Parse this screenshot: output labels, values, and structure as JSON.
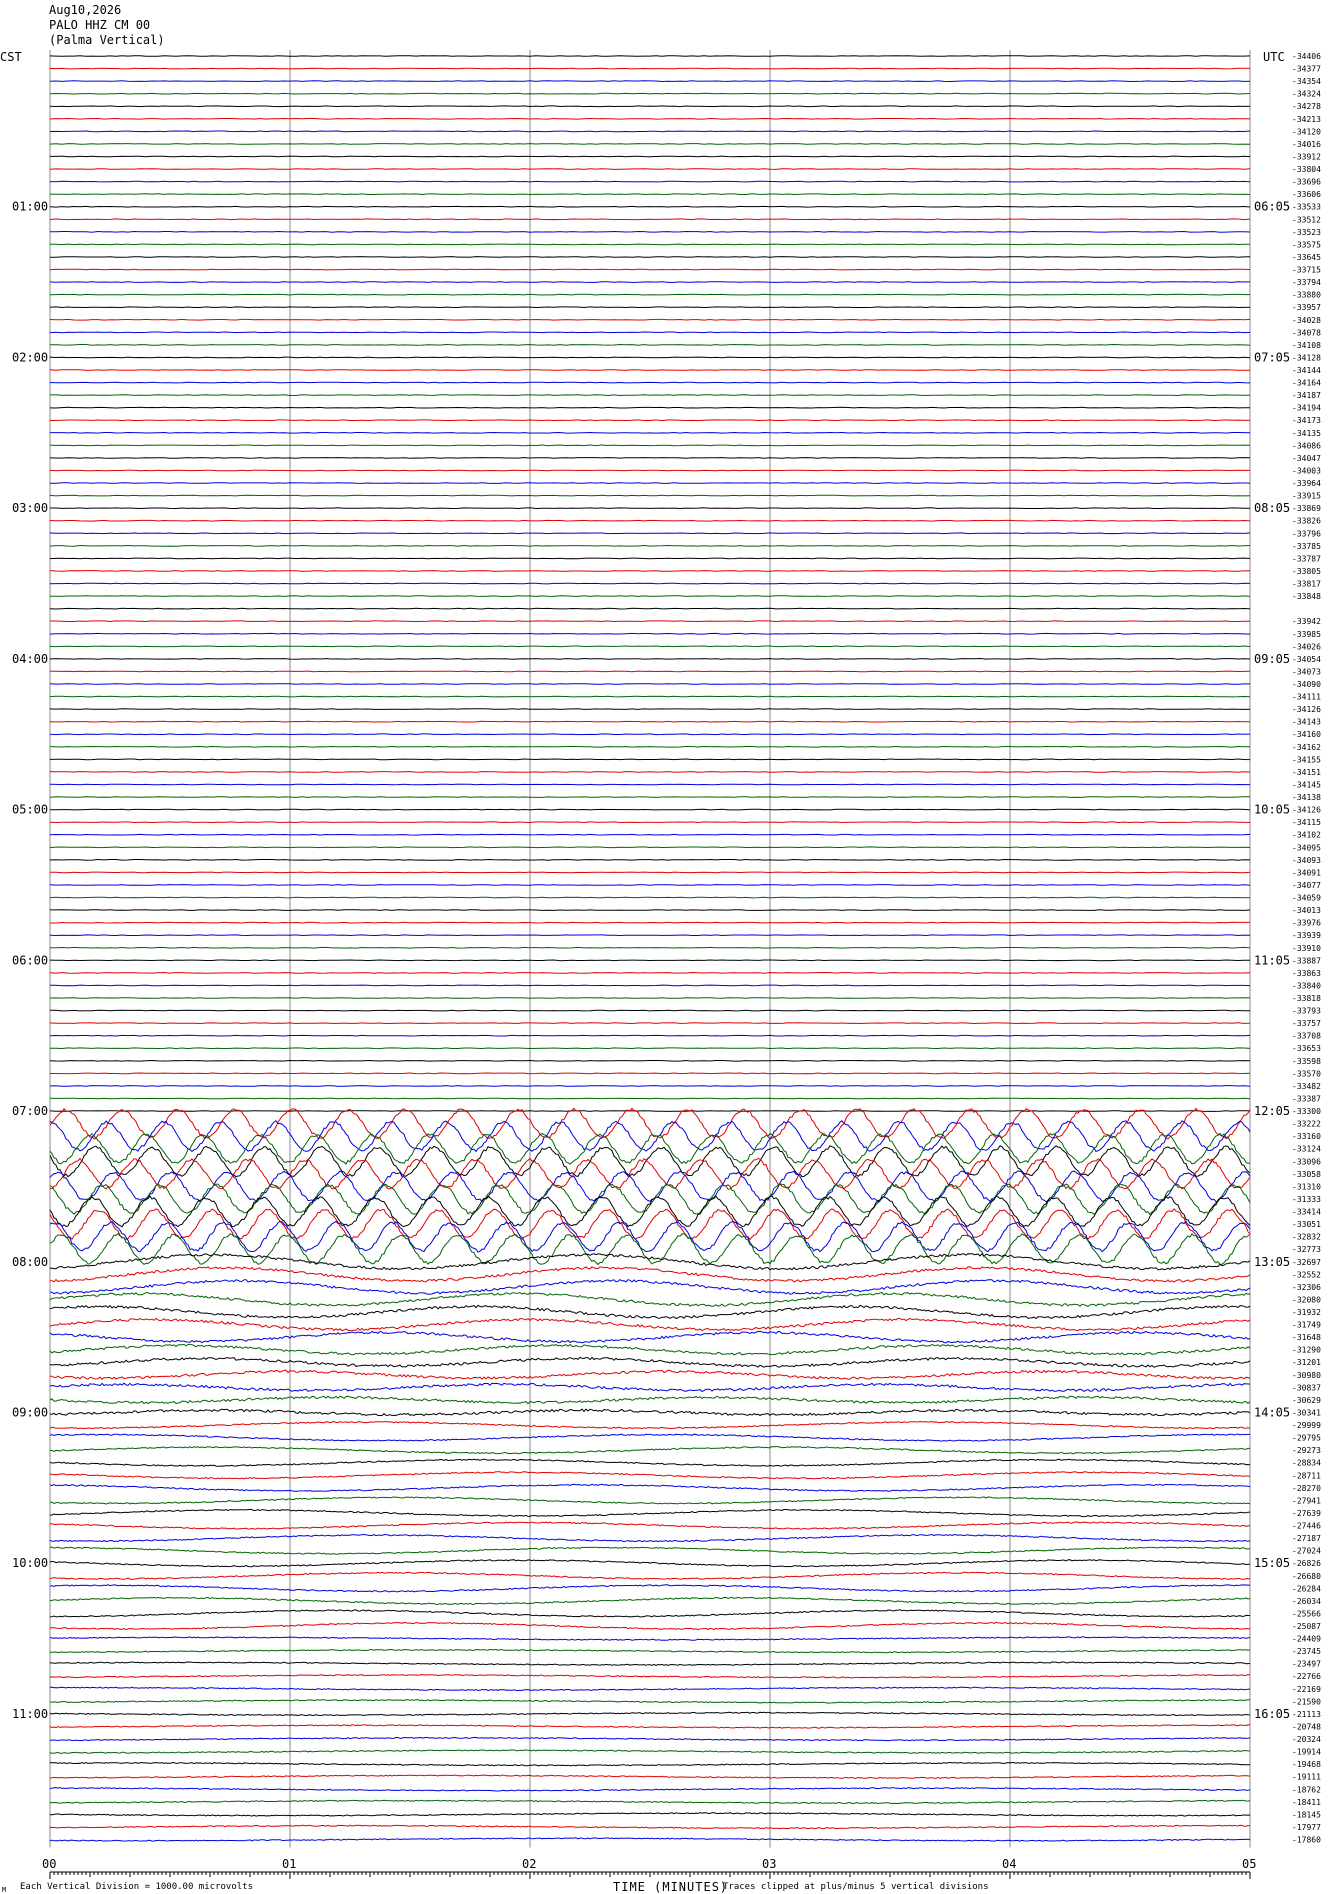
{
  "header": {
    "date": "Aug10,2026",
    "station": "PALO HHZ CM 00",
    "location": "(Palma Vertical)"
  },
  "left_timezone": "CST",
  "right_timezone": "UTC",
  "left_hour_labels": [
    "01:00",
    "02:00",
    "03:00",
    "04:00",
    "05:00",
    "06:00",
    "07:00",
    "08:00",
    "09:00",
    "10:00",
    "11:00"
  ],
  "right_hour_labels": [
    "06:05",
    "07:05",
    "08:05",
    "09:05",
    "10:05",
    "11:05",
    "12:05",
    "13:05",
    "14:05",
    "15:05",
    "16:05"
  ],
  "trace_offsets": [
    "-34406",
    "-34377",
    "-34354",
    "-34324",
    "-34278",
    "-34213",
    "-34120",
    "-34016",
    "-33912",
    "-33804",
    "-33696",
    "-33606",
    "-33533",
    "-33512",
    "-33523",
    "-33575",
    "-33645",
    "-33715",
    "-33794",
    "-33880",
    "-33957",
    "-34028",
    "-34078",
    "-34108",
    "-34128",
    "-34144",
    "-34164",
    "-34187",
    "-34194",
    "-34173",
    "-34135",
    "-34086",
    "-34047",
    "-34003",
    "-33964",
    "-33915",
    "-33869",
    "-33826",
    "-33796",
    "-33785",
    "-33787",
    "-33805",
    "-33817",
    "-33848",
    "",
    "-33942",
    "-33985",
    "-34026",
    "-34054",
    "-34073",
    "-34090",
    "-34111",
    "-34126",
    "-34143",
    "-34160",
    "-34162",
    "-34155",
    "-34151",
    "-34145",
    "-34138",
    "-34126",
    "-34115",
    "-34102",
    "-34095",
    "-34093",
    "-34091",
    "-34077",
    "-34059",
    "-34013",
    "-33976",
    "-33939",
    "-33910",
    "-33887",
    "-33863",
    "-33840",
    "-33818",
    "-33793",
    "-33757",
    "-33708",
    "-33653",
    "-33598",
    "-33570",
    "-33482",
    "-33387",
    "-33300",
    "-33222",
    "-33160",
    "-33124",
    "-33096",
    "-33058",
    "-31310",
    "-31333",
    "-33414",
    "-33051",
    "-32832",
    "-32773",
    "-32697",
    "-32552",
    "-32306",
    "-32080",
    "-31932",
    "-31749",
    "-31648",
    "-31290",
    "-31201",
    "-30980",
    "-30837",
    "-30629",
    "-30341",
    "-29999",
    "-29795",
    "-29273",
    "-28834",
    "-28711",
    "-28270",
    "-27941",
    "-27639",
    "-27446",
    "-27187",
    "-27024",
    "-26826",
    "-26680",
    "-26284",
    "-26034",
    "-25566",
    "-25087",
    "-24409",
    "-23745",
    "-23497",
    "-22766",
    "-22169",
    "-21590",
    "-21113",
    "-20748",
    "-20324",
    "-19914",
    "-19468",
    "-19111",
    "-18762",
    "-18411",
    "-18145",
    "-17977",
    "-17860"
  ],
  "x_tick_labels": [
    "00",
    "01",
    "02",
    "03",
    "04",
    "05"
  ],
  "footer": {
    "scale_note": "Each Vertical Division = 1000.00 microvolts",
    "axis_title": "TIME (MINUTES)",
    "clip_note": "Traces clipped at plus/minus 5 vertical divisions",
    "corner_mark": "M"
  },
  "trace_colors": [
    "#000000",
    "#e00000",
    "#0000e0",
    "#006400"
  ]
}
